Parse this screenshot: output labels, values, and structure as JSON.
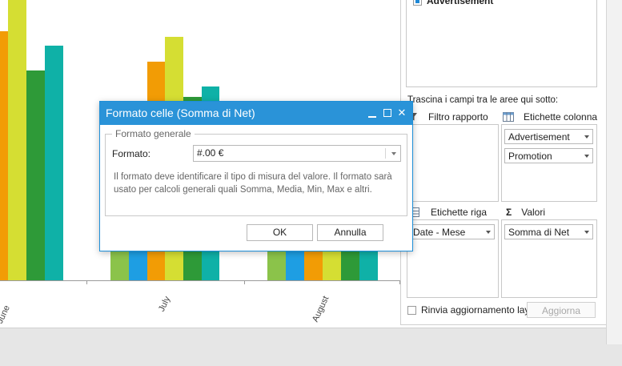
{
  "chart": {
    "x_labels": [
      "June",
      "July",
      "August"
    ],
    "colors": [
      "#8bc34a",
      "#f29c05",
      "#d5de33",
      "#2e9a38",
      "#0fb1a7",
      "#1e9ee3"
    ]
  },
  "pivot_panel": {
    "field_list_items": [
      {
        "label": "Advertisement",
        "checked": true
      }
    ],
    "drag_hint": "Trascina i campi tra le aree qui sotto:",
    "report_filter_label": "Filtro rapporto",
    "column_labels_label": "Etichette colonna",
    "column_fields": [
      "Advertisement",
      "Promotion"
    ],
    "row_labels_label": "Etichette riga",
    "row_fields": [
      "Date - Mese"
    ],
    "values_label": "Valori",
    "value_fields": [
      "Somma di Net"
    ],
    "defer_update_label": "Rinvia aggiornamento layout",
    "update_button": "Aggiorna"
  },
  "dialog": {
    "title": "Formato celle (Somma di Net)",
    "group_title": "Formato generale",
    "format_label": "Formato:",
    "format_value": "#.00 €",
    "description": "Il formato deve identificare il tipo di misura del valore. Il formato sarà usato per calcoli generali quali Somma, Media, Min, Max e altri.",
    "ok_label": "OK",
    "cancel_label": "Annulla"
  }
}
